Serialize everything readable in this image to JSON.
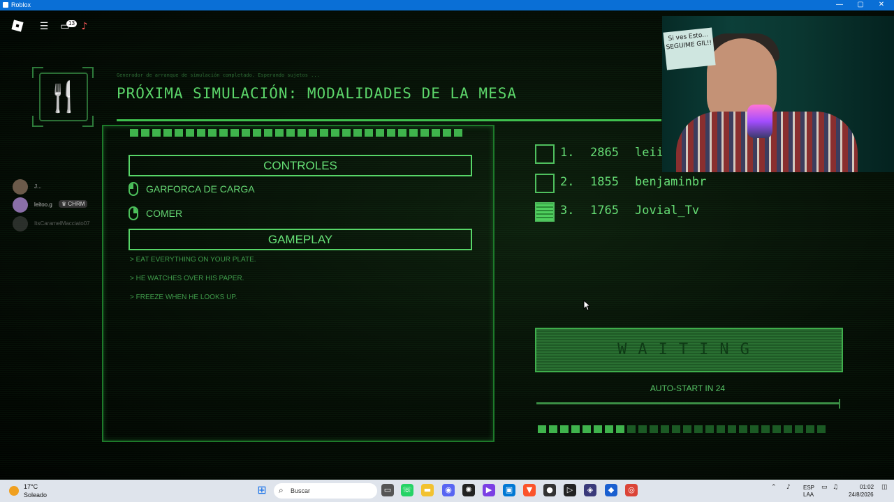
{
  "window": {
    "title": "Roblox",
    "min": "—",
    "max": "▢",
    "close": "✕"
  },
  "topbar": {
    "menu_icon": "hamburger-icon",
    "chat_badge": "13",
    "chat_icon": "chat-icon",
    "mic_icon": "mic-icon"
  },
  "players": [
    {
      "name": "J...",
      "tag": ""
    },
    {
      "name": "leitoo.g",
      "tag": "♛ CHRM"
    },
    {
      "name": "ItsCaramelMacciato07",
      "tag": ""
    }
  ],
  "screen": {
    "subtitle": "Generador de arranque de simulación completado. Esperando sujetos ...",
    "title": "PRÓXIMA SIMULACIÓN: MODALIDADES DE LA MESA",
    "icon": "fork-knife-icon"
  },
  "controls": {
    "header": "CONTROLES",
    "items": [
      {
        "label": "GARFORCA DE CARGA",
        "icon": "mouse-left-icon"
      },
      {
        "label": "COMER",
        "icon": "mouse-right-icon"
      }
    ]
  },
  "gameplay": {
    "header": "GAMEPLAY",
    "rules": [
      "> EAT EVERYTHING ON YOUR PLATE.",
      "> HE WATCHES OVER HIS PAPER.",
      "> FREEZE WHEN HE LOOKS UP."
    ]
  },
  "leaderboard": [
    {
      "rank": "1.",
      "points": "2865",
      "name": "leii",
      "checked": false
    },
    {
      "rank": "2.",
      "points": "1855",
      "name": "benjaminbr",
      "checked": false
    },
    {
      "rank": "3.",
      "points": "1765",
      "name": "Jovial_Tv",
      "checked": true
    }
  ],
  "status": {
    "waiting": "WAITING",
    "autostart": "AUTO-START IN 24",
    "progress": 1.0
  },
  "webcam": {
    "note": "Si ves Esto... SEGUIME GIL!!"
  },
  "taskbar": {
    "weather_temp": "17°C",
    "weather_desc": "Soleado",
    "search": "Buscar",
    "lang1": "ESP",
    "lang2": "LAA",
    "time": "01:02",
    "date": "24/8/2026"
  },
  "colors": {
    "accent": "#5cd66a",
    "titlebar": "#0a6fd6",
    "taskbar": "#dfe4ec"
  }
}
